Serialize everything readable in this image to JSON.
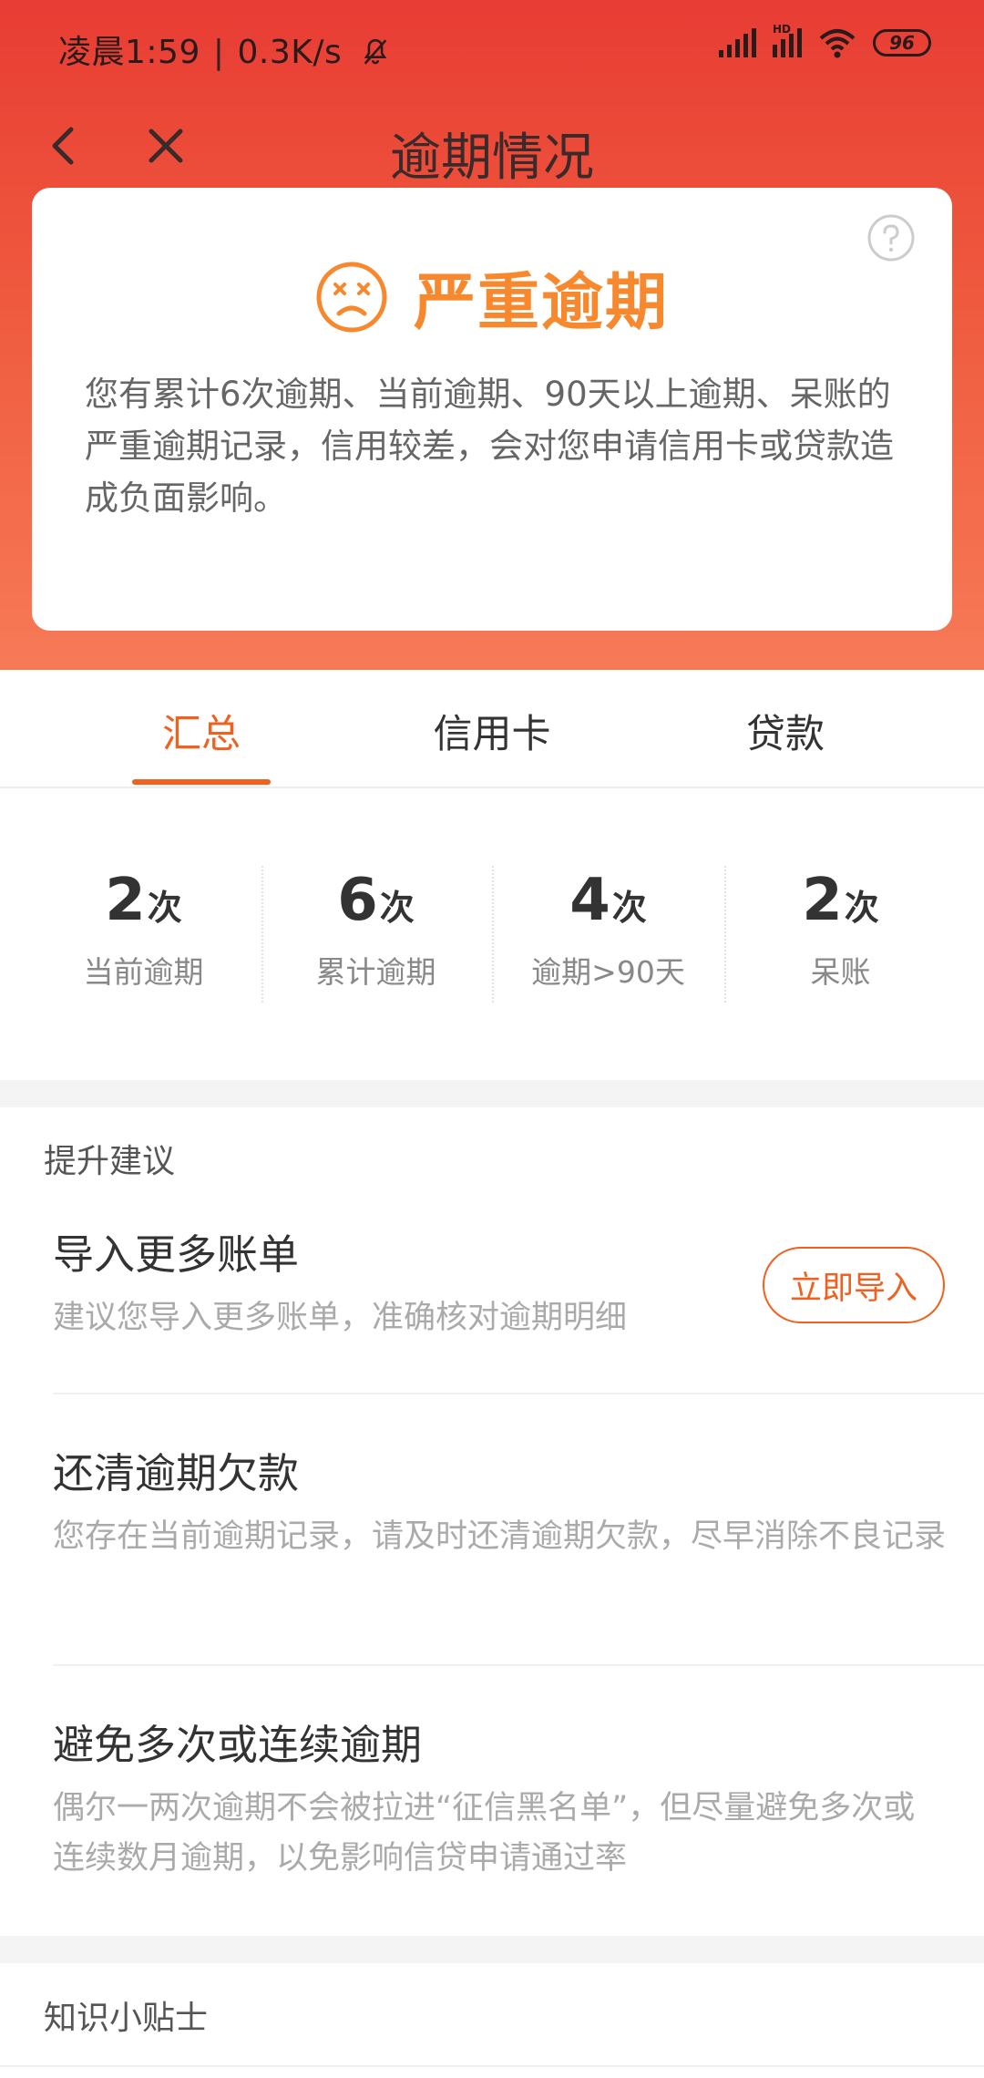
{
  "status_bar": {
    "time": "凌晨1:59",
    "network_speed": "0.3K/s",
    "battery": "96",
    "hd_label": "HD",
    "icons": [
      "bell-off-icon",
      "signal-icon",
      "hd-signal-icon",
      "wifi-icon",
      "battery-icon"
    ]
  },
  "nav": {
    "title": "逾期情况",
    "back_icon": "chevron-left-icon",
    "close_icon": "close-icon"
  },
  "summary_card": {
    "level": "严重逾期",
    "level_icon": "sad-face-icon",
    "help_icon": "question-circle-icon",
    "description": "您有累计6次逾期、当前逾期、90天以上逾期、呆账的严重逾期记录，信用较差，会对您申请信用卡或贷款造成负面影响。"
  },
  "tabs": [
    {
      "label": "汇总",
      "active": true
    },
    {
      "label": "信用卡",
      "active": false
    },
    {
      "label": "贷款",
      "active": false
    }
  ],
  "stats": [
    {
      "value": "2",
      "unit": "次",
      "label": "当前逾期"
    },
    {
      "value": "6",
      "unit": "次",
      "label": "累计逾期"
    },
    {
      "value": "4",
      "unit": "次",
      "label": "逾期>90天"
    },
    {
      "value": "2",
      "unit": "次",
      "label": "呆账"
    }
  ],
  "suggestions": {
    "section_title": "提升建议",
    "items": [
      {
        "title": "导入更多账单",
        "desc": "建议您导入更多账单，准确核对逾期明细",
        "button": "立即导入"
      },
      {
        "title": "还清逾期欠款",
        "desc": "您存在当前逾期记录，请及时还清逾期欠款，尽早消除不良记录"
      },
      {
        "title": "避免多次或连续逾期",
        "desc": "偶尔一两次逾期不会被拉进“征信黑名单”，但尽量避免多次或连续数月逾期，以免影响信贷申请通过率"
      }
    ]
  },
  "tips": {
    "section_title": "知识小贴士"
  },
  "colors": {
    "header_top": "#e83c34",
    "header_bottom": "#f77a57",
    "accent": "#f0601e",
    "severity": "#f7882e"
  }
}
